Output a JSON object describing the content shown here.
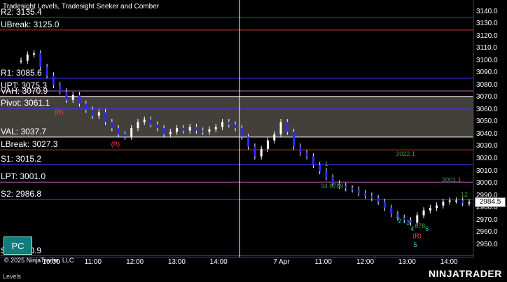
{
  "chart_title": "Tradesight Levels, Tradesight Seeker and Comber",
  "levels": [
    {
      "label": "R2: 3135.4",
      "price": 3135.4,
      "color": "#3a3aff",
      "style": "solid"
    },
    {
      "label": "UBreak: 3125.0",
      "price": 3125.0,
      "color": "#d03030",
      "style": "solid"
    },
    {
      "label": "R1: 3085.6",
      "price": 3085.6,
      "color": "#3a3aff",
      "style": "solid"
    },
    {
      "label": "UPT: 3075.3",
      "price": 3075.3,
      "color": "#c060c0",
      "style": "solid"
    },
    {
      "label": "VAH: 3070.9",
      "price": 3070.9,
      "color": "#ffffff",
      "style": "solid"
    },
    {
      "label": "Pivot: 3061.1",
      "price": 3061.1,
      "color": "#3a3aff",
      "style": "solid"
    },
    {
      "label": "VAL: 3037.7",
      "price": 3037.7,
      "color": "#ffffff",
      "style": "solid"
    },
    {
      "label": "LBreak: 3027.3",
      "price": 3027.3,
      "color": "#d03030",
      "style": "solid"
    },
    {
      "label": "S1: 3015.2",
      "price": 3015.2,
      "color": "#3a3aff",
      "style": "solid"
    },
    {
      "label": "LPT: 3001.0",
      "price": 3001.0,
      "color": "#c060c0",
      "style": "solid"
    },
    {
      "label": "S2: 2986.8",
      "price": 2986.8,
      "color": "#3a3aff",
      "style": "solid"
    },
    {
      "label": "S3: 2940.9",
      "price": 2940.9,
      "color": "#3a3aff",
      "style": "solid"
    }
  ],
  "value_area": {
    "high": 3070.9,
    "low": 3037.7,
    "color": "#5a5650"
  },
  "price_axis": {
    "min": 2943,
    "max": 3146,
    "ticks": [
      "3140.0",
      "3130.0",
      "3120.0",
      "3110.0",
      "3100.0",
      "3090.0",
      "3080.0",
      "3070.0",
      "3060.0",
      "3050.0",
      "3040.0",
      "3030.0",
      "3020.0",
      "3010.0",
      "3000.0",
      "2990.0",
      "2980.0",
      "2970.0",
      "2960.0",
      "2950.0"
    ]
  },
  "time_axis": {
    "ticks": [
      {
        "label": "10:00",
        "slot": 0
      },
      {
        "label": "11:00",
        "slot": 1
      },
      {
        "label": "12:00",
        "slot": 2
      },
      {
        "label": "13:00",
        "slot": 3
      },
      {
        "label": "14:00",
        "slot": 4
      },
      {
        "label": "7 Apr",
        "slot": 5.5
      },
      {
        "label": "11:00",
        "slot": 6.5
      },
      {
        "label": "12:00",
        "slot": 7.5
      },
      {
        "label": "13:00",
        "slot": 8.5
      },
      {
        "label": "14:00",
        "slot": 9.5
      }
    ]
  },
  "session_break_slot": 4.6,
  "last_price": "2984.5",
  "chart_data": {
    "type": "line",
    "title": "Tradesight Levels, Tradesight Seeker and Comber",
    "series": [
      {
        "values": [
          3100,
          3105,
          3106,
          3095,
          3088,
          3080,
          3075,
          3068,
          3072,
          3065,
          3060,
          3055,
          3058,
          3050,
          3045,
          3040,
          3038,
          3045,
          3050,
          3052,
          3048,
          3045,
          3040,
          3042,
          3045,
          3043,
          3046,
          3043,
          3042,
          3044,
          3046,
          3050,
          3048,
          3045,
          3038,
          3030,
          3022,
          3028,
          3035,
          3040,
          3050,
          3042,
          3030,
          3025,
          3022,
          3015,
          3010,
          3005,
          3000,
          2998,
          2996,
          2995,
          2992,
          2990,
          2988,
          2985,
          2980,
          2975,
          2972,
          2970,
          2968,
          2974,
          2978,
          2980,
          2982,
          2985,
          2986,
          2986,
          2984,
          2984.5
        ]
      }
    ]
  },
  "annotations": [
    {
      "text": "(R)",
      "price": 3058,
      "slot": 0.15,
      "color": "#ff4040"
    },
    {
      "text": "(R)",
      "price": 3032,
      "slot": 1.5,
      "color": "#ff4040"
    },
    {
      "text": "3022.1",
      "price": 3024,
      "slot": 8.3,
      "color": "#3a9a3a"
    },
    {
      "text": "3001.1",
      "price": 3003,
      "slot": 9.4,
      "color": "#3a9a3a"
    },
    {
      "text": "12",
      "price": 2991,
      "slot": 9.85,
      "color": "#3a9a3a"
    },
    {
      "text": "1",
      "price": 3016,
      "slot": 6.6,
      "color": "#3a9a3a"
    },
    {
      "text": "34 6789",
      "price": 2998,
      "slot": 6.5,
      "color": "#3a9a3a"
    },
    {
      "text": "1",
      "price": 2974,
      "slot": 8.3,
      "color": "#33d0d0"
    },
    {
      "text": "2",
      "price": 2969,
      "slot": 8.35,
      "color": "#33d0d0"
    },
    {
      "text": "3",
      "price": 2968,
      "slot": 8.55,
      "color": "#33d0d0"
    },
    {
      "text": "4",
      "price": 2963,
      "slot": 8.65,
      "color": "#33d0d0"
    },
    {
      "text": "678",
      "price": 2965,
      "slot": 8.75,
      "color": "#3a9a3a"
    },
    {
      "text": "6",
      "price": 2963,
      "slot": 9.0,
      "color": "#33d0d0"
    },
    {
      "text": "(R)",
      "price": 2957,
      "slot": 8.7,
      "color": "#ff4040"
    },
    {
      "text": "5",
      "price": 2950,
      "slot": 8.72,
      "color": "#33d0d0"
    }
  ],
  "buttons": {
    "pc": "PC"
  },
  "copyright": "© 2025 NinjaTrader, LLC",
  "panel_label": "Levels",
  "brand": "NINJATRADER"
}
